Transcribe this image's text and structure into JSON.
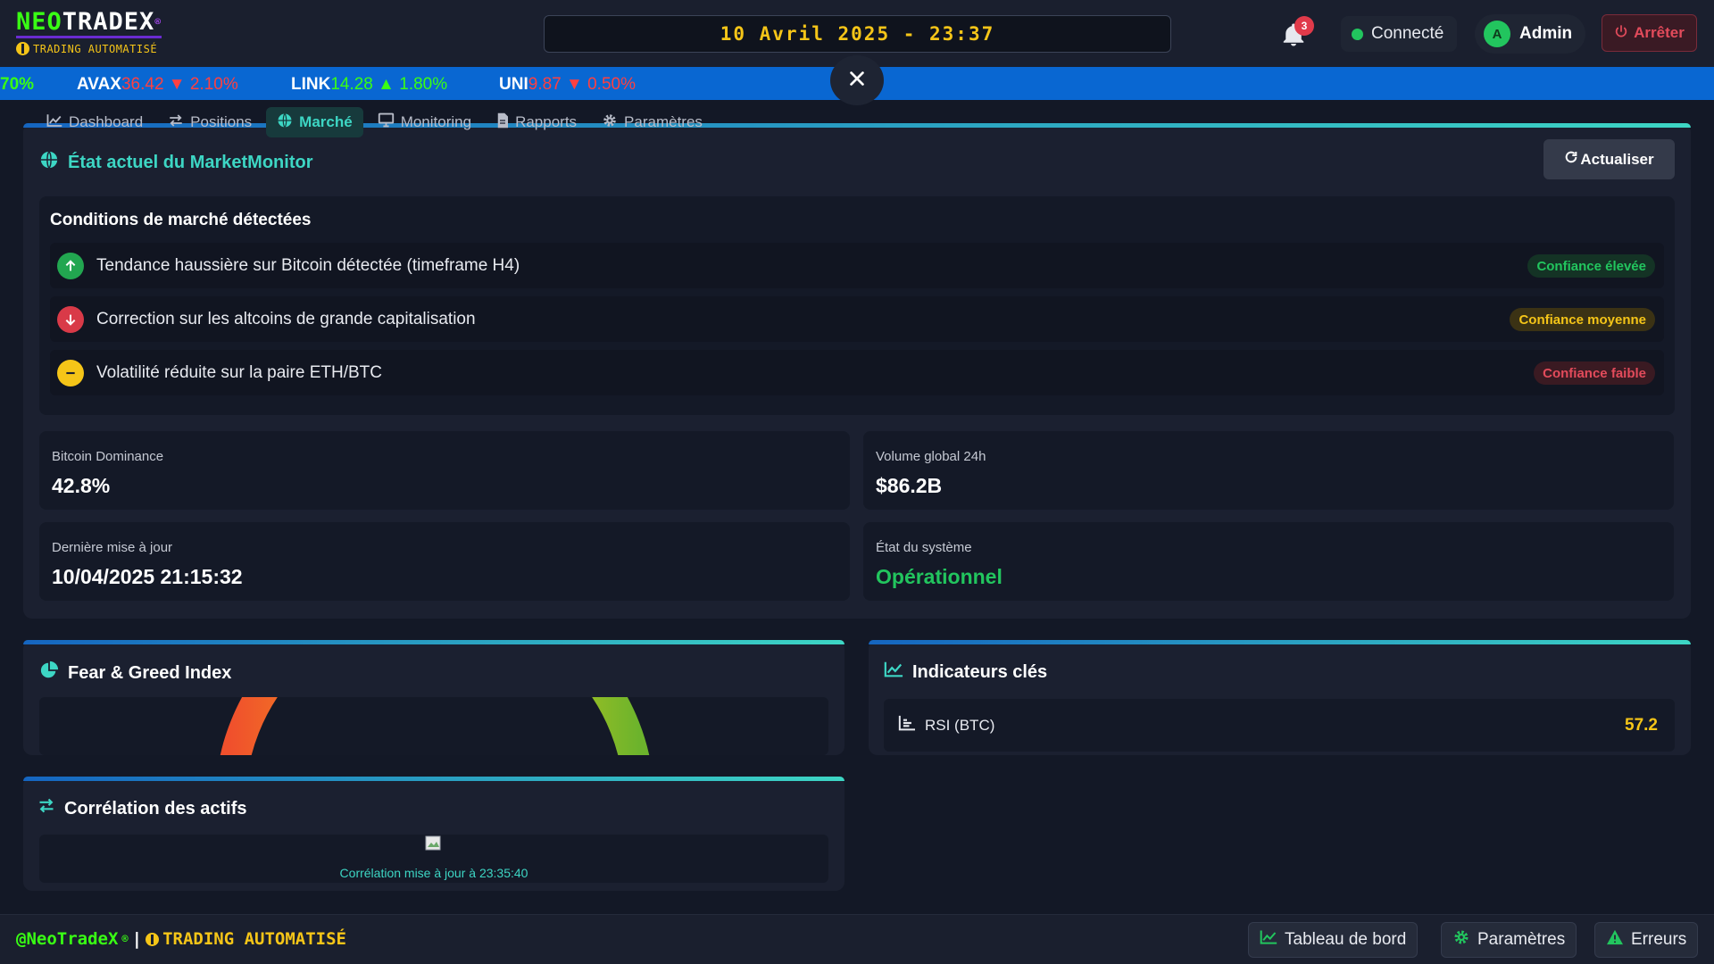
{
  "header": {
    "logo_neo": "NEO",
    "logo_rest": "TRADEX",
    "logo_tm": "®",
    "logo_subtitle": "TRADING AUTOMATISÉ",
    "datetime": "10 Avril 2025 - 23:37",
    "notifications_count": "3",
    "connection_status": "Connecté",
    "user_initial": "A",
    "user_name": "Admin",
    "stop_label": "Arrêter"
  },
  "ticker": {
    "first_fragment": "70%",
    "items": [
      {
        "symbol": "AVAX",
        "price": "36.42",
        "arrow": "▼",
        "change": "2.10%",
        "direction": "down"
      },
      {
        "symbol": "LINK",
        "price": "14.28",
        "arrow": "▲",
        "change": "1.80%",
        "direction": "up"
      },
      {
        "symbol": "UNI",
        "price": "9.87",
        "arrow": "▼",
        "change": "0.50%",
        "direction": "down"
      }
    ],
    "close_icon": "close-icon"
  },
  "tabs": [
    {
      "label": "Dashboard",
      "icon": "chart-line-icon",
      "active": false
    },
    {
      "label": "Positions",
      "icon": "exchange-icon",
      "active": false
    },
    {
      "label": "Marché",
      "icon": "globe-icon",
      "active": true
    },
    {
      "label": "Monitoring",
      "icon": "monitor-icon",
      "active": false
    },
    {
      "label": "Rapports",
      "icon": "document-icon",
      "active": false
    },
    {
      "label": "Paramètres",
      "icon": "gear-icon",
      "active": false
    }
  ],
  "market_monitor": {
    "title": "État actuel du MarketMonitor",
    "refresh_label": "Actualiser",
    "conditions_heading": "Conditions de marché détectées",
    "conditions": [
      {
        "text": "Tendance haussière sur Bitcoin détectée (timeframe H4)",
        "confidence": "Confiance élevée",
        "level": "high",
        "icon": "arrow-up-icon"
      },
      {
        "text": "Correction sur les altcoins de grande capitalisation",
        "confidence": "Confiance moyenne",
        "level": "med",
        "icon": "arrow-down-icon"
      },
      {
        "text": "Volatilité réduite sur la paire ETH/BTC",
        "confidence": "Confiance faible",
        "level": "low",
        "icon": "minus-icon"
      }
    ],
    "stats": [
      {
        "label": "Bitcoin Dominance",
        "value": "42.8%"
      },
      {
        "label": "Volume global 24h",
        "value": "$86.2B"
      },
      {
        "label": "Dernière mise à jour",
        "value": "10/04/2025 21:15:32"
      },
      {
        "label": "État du système",
        "value": "Opérationnel"
      }
    ]
  },
  "fear_greed": {
    "title": "Fear & Greed Index"
  },
  "indicators": {
    "title": "Indicateurs clés",
    "items": [
      {
        "label": "RSI (BTC)",
        "value": "57.2"
      }
    ]
  },
  "correlation": {
    "title": "Corrélation des actifs",
    "note": "Corrélation mise à jour à 23:35:40"
  },
  "footer": {
    "brand_handle": "@NeoTradeX",
    "brand_tm": "®",
    "separator": "|",
    "brand_tagline": "TRADING AUTOMATISÉ",
    "buttons": [
      {
        "label": "Tableau de bord",
        "icon": "chart-line-icon"
      },
      {
        "label": "Paramètres",
        "icon": "gear-icon"
      },
      {
        "label": "Erreurs",
        "icon": "warning-icon"
      }
    ]
  },
  "colors": {
    "accent_teal": "#3dd6c4",
    "neon_green": "#39ff14",
    "gold": "#f5c518",
    "ticker_blue": "#0967d2",
    "danger": "#e24b5b",
    "success": "#22c55e"
  }
}
